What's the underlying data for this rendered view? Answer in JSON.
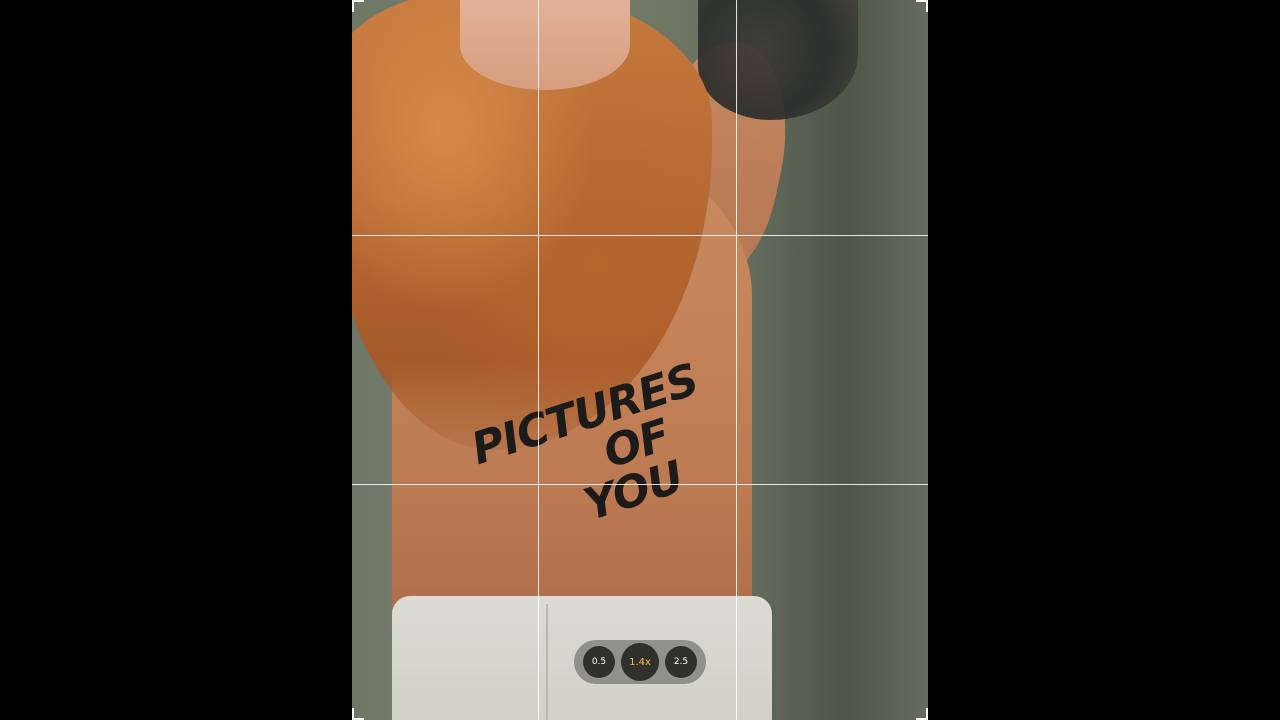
{
  "camera": {
    "tattoo_text": {
      "line1": "PICTURES",
      "line2": "OF",
      "line3": "YOU"
    },
    "zoom_levels": [
      {
        "label": "0.5",
        "selected": false
      },
      {
        "label": "1.4x",
        "selected": true
      },
      {
        "label": "2.5",
        "selected": false
      }
    ],
    "grid": "3x3",
    "colors": {
      "active_zoom": "#f1c24a",
      "grid_lines": "#ffffff"
    }
  }
}
